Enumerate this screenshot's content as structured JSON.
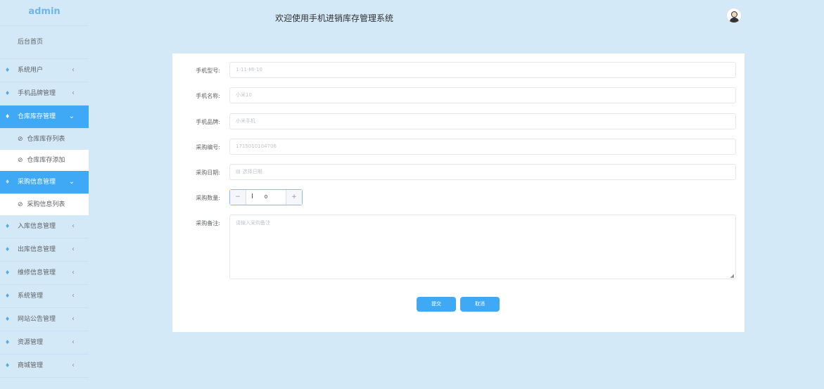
{
  "sidebar": {
    "brand": "admin",
    "home": "后台首页",
    "menus": [
      {
        "label": "系统用户",
        "chevron": "‹"
      },
      {
        "label": "手机品牌管理",
        "chevron": "‹"
      },
      {
        "label": "仓库库存管理",
        "chevron": "⌄"
      },
      {
        "label": "仓库库存列表"
      },
      {
        "label": "仓库库存添加"
      },
      {
        "label": "采购信息管理",
        "chevron": "⌄"
      },
      {
        "label": "采购信息列表"
      },
      {
        "label": "入库信息管理",
        "chevron": "‹"
      },
      {
        "label": "出库信息管理",
        "chevron": "‹"
      },
      {
        "label": "维修信息管理",
        "chevron": "‹"
      },
      {
        "label": "系统管理",
        "chevron": "‹"
      },
      {
        "label": "网站公告管理",
        "chevron": "‹"
      },
      {
        "label": "资源管理",
        "chevron": "‹"
      },
      {
        "label": "商城管理",
        "chevron": "‹"
      }
    ]
  },
  "header": {
    "title": "欢迎使用手机进销库存管理系统"
  },
  "form": {
    "fields": [
      {
        "label": "手机型号:",
        "value": "1-11-MI-10"
      },
      {
        "label": "手机名称:",
        "value": "小米10"
      },
      {
        "label": "手机品牌:",
        "value": "小米手机"
      },
      {
        "label": "采购编号:",
        "value": "1715010104706"
      },
      {
        "label": "采购日期:",
        "placeholder": "选择日期"
      },
      {
        "label": "采购数量:",
        "value": "0",
        "dec": "−",
        "inc": "+"
      },
      {
        "label": "采购备注:",
        "placeholder": "请输入采购备注"
      }
    ],
    "submit": "提交",
    "cancel": "取消"
  },
  "icons": {
    "gem": "♦",
    "clock": "⊘",
    "calendar": "▤",
    "cursor": "I",
    "grip": "◢"
  },
  "colors": {
    "background": "#d4e9f7",
    "accent": "#3fa9f5",
    "brand": "#6fb7ea"
  }
}
